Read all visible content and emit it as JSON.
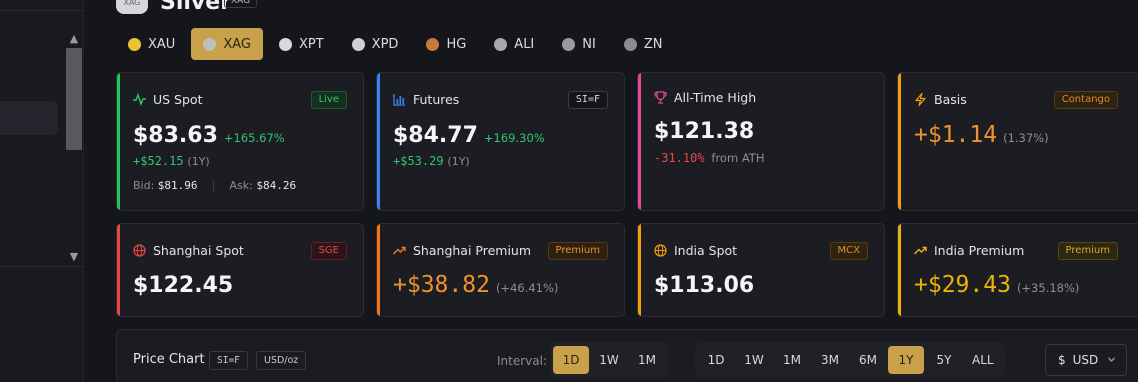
{
  "header": {
    "logo_text": "XAG",
    "title": "Silver",
    "badge": "XAG"
  },
  "metal_tabs": [
    {
      "label": "XAU",
      "color": "#e8c531",
      "active": false
    },
    {
      "label": "XAG",
      "color": "#bfbfbf",
      "active": true
    },
    {
      "label": "XPT",
      "color": "#d9d9d9",
      "active": false
    },
    {
      "label": "XPD",
      "color": "#cfcfcf",
      "active": false
    },
    {
      "label": "HG",
      "color": "#c77b3a",
      "active": false
    },
    {
      "label": "ALI",
      "color": "#a9a9a9",
      "active": false
    },
    {
      "label": "NI",
      "color": "#9a9a9a",
      "active": false
    },
    {
      "label": "ZN",
      "color": "#8c8c8c",
      "active": false
    }
  ],
  "cards": {
    "us_spot": {
      "title": "US Spot",
      "tag": "Live",
      "price": "$83.63",
      "pct": "+165.67%",
      "change": "+$52.15",
      "period": "(1Y)",
      "bid_label": "Bid:",
      "bid": "$81.96",
      "ask_label": "Ask:",
      "ask": "$84.26",
      "accent": "#22c55e"
    },
    "futures": {
      "title": "Futures",
      "tag": "SI=F",
      "price": "$84.77",
      "pct": "+169.30%",
      "change": "+$53.29",
      "period": "(1Y)",
      "accent": "#3b82f6"
    },
    "ath": {
      "title": "All-Time High",
      "price": "$121.38",
      "change": "-31.10%",
      "from": "from ATH",
      "accent": "#ec4899"
    },
    "basis": {
      "title": "Basis",
      "tag": "Contango",
      "price": "+$1.14",
      "pct": "(1.37%)",
      "accent": "#f59e0b"
    },
    "shanghai_spot": {
      "title": "Shanghai Spot",
      "tag": "SGE",
      "price": "$122.45",
      "accent": "#ef4444"
    },
    "shanghai_premium": {
      "title": "Shanghai Premium",
      "tag": "Premium",
      "price": "+$38.82",
      "pct": "(+46.41%)",
      "accent": "#f97316"
    },
    "india_spot": {
      "title": "India Spot",
      "tag": "MCX",
      "price": "$113.06",
      "accent": "#f59e0b"
    },
    "india_premium": {
      "title": "India Premium",
      "tag": "Premium",
      "price": "+$29.43",
      "pct": "(+35.18%)",
      "accent": "#eab308"
    }
  },
  "price_chart": {
    "title": "Price Chart",
    "ticker": "SI=F",
    "unit": "USD/oz",
    "interval_label": "Interval:",
    "intervals": [
      "1D",
      "1W",
      "1M"
    ],
    "active_interval": "1D",
    "ranges": [
      "1D",
      "1W",
      "1M",
      "3M",
      "6M",
      "1Y",
      "5Y",
      "ALL"
    ],
    "active_range": "1Y",
    "currency_symbol": "$",
    "currency": "USD"
  }
}
